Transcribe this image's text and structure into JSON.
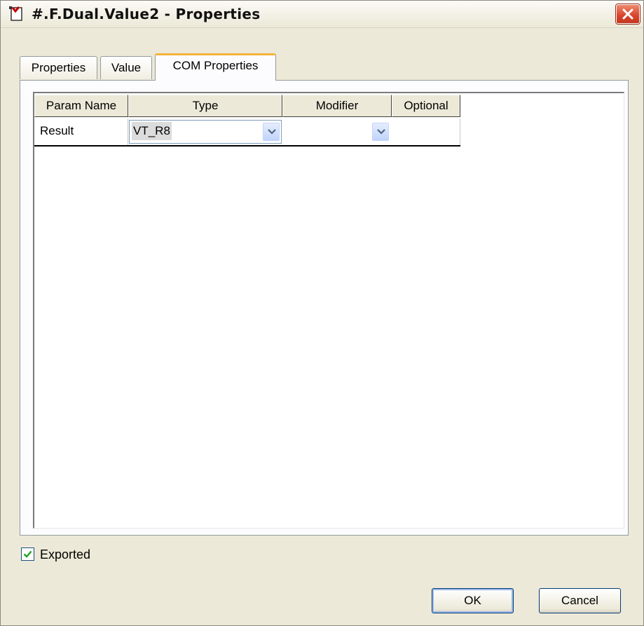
{
  "window": {
    "title": "#.F.Dual.Value2 - Properties"
  },
  "tabs": [
    {
      "label": "Properties",
      "active": false
    },
    {
      "label": "Value",
      "active": false
    },
    {
      "label": "COM Properties",
      "active": true
    }
  ],
  "grid": {
    "columns": [
      "Param Name",
      "Type",
      "Modifier",
      "Optional"
    ],
    "rows": [
      {
        "param_name": "Result",
        "type": "VT_R8",
        "modifier": "",
        "optional": ""
      }
    ]
  },
  "exported": {
    "label": "Exported",
    "checked": true
  },
  "buttons": {
    "ok": "OK",
    "cancel": "Cancel"
  },
  "colors": {
    "accent_tab": "#f4b43c",
    "close_button": "#d8432a",
    "checkmark": "#21a121"
  },
  "icons": {
    "title": "properties-page-icon",
    "close": "close-x-icon",
    "dropdown": "chevron-down-icon",
    "check": "checkmark-icon"
  }
}
